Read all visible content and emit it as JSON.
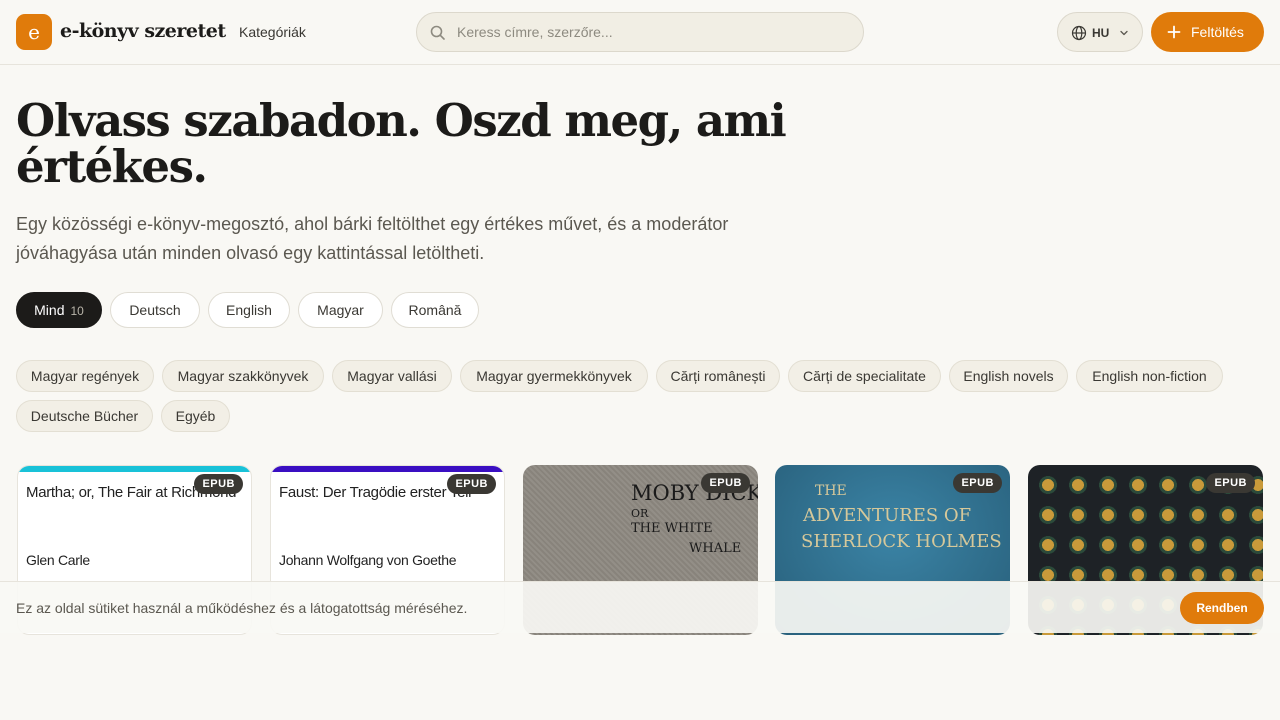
{
  "header": {
    "logo_letter": "e",
    "logo_text": "e-könyv szeretet",
    "nav_categories": "Kategóriák",
    "search_placeholder": "Keress címre, szerzőre...",
    "lang_code": "HU",
    "upload_label": "Feltöltés"
  },
  "hero": {
    "title": "Olvass szabadon. Oszd meg, ami értékes.",
    "subtitle": "Egy közösségi e-könyv-megosztó, ahol bárki feltölthet egy értékes művet, és a moderátor jóváhagyása után minden olvasó egy kattintással letöltheti."
  },
  "language_filters": [
    {
      "label": "Mind",
      "count": "10",
      "active": true
    },
    {
      "label": "Deutsch"
    },
    {
      "label": "English"
    },
    {
      "label": "Magyar"
    },
    {
      "label": "Română"
    }
  ],
  "category_chips": [
    "Magyar regények",
    "Magyar szakkönyvek",
    "Magyar vallási",
    "Magyar gyermekkönyvek",
    "Cărți românești",
    "Cărți de specialitate",
    "English novels",
    "English non-fiction",
    "Deutsche Bücher",
    "Egyéb"
  ],
  "books": [
    {
      "format": "EPUB",
      "cover_title": "Martha; or, The Fair at Richmond",
      "cover_author": "Glen Carle",
      "accent": "#19c2d8"
    },
    {
      "format": "EPUB",
      "cover_title": "Faust: Der Tragödie erster Teil",
      "cover_author": "Johann Wolfgang von Goethe",
      "accent": "#3a0fc2"
    },
    {
      "format": "EPUB",
      "cover_line1": "MOBY DICK",
      "cover_line2": "OR",
      "cover_line3": "THE WHITE",
      "cover_line4": "WHALE"
    },
    {
      "format": "EPUB",
      "cover_line1": "THE",
      "cover_line2": "ADVENTURES OF",
      "cover_line3": "SHERLOCK HOLMES"
    },
    {
      "format": "EPUB"
    }
  ],
  "cookie": {
    "message": "Ez az oldal sütiket használ a működéshez és a látogatottság méréséhez.",
    "accept": "Rendben"
  },
  "colors": {
    "accent": "#e07b0b",
    "background": "#f9f8f4",
    "dark": "#1c1b19"
  }
}
